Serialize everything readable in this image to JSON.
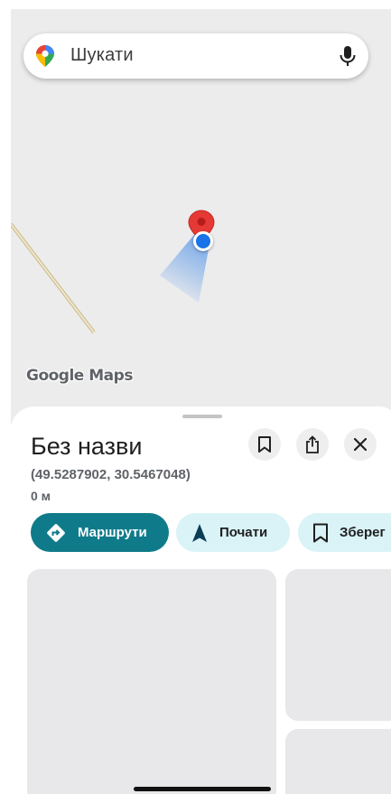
{
  "search": {
    "placeholder": "Шукати",
    "logo_icon": "google-maps-pin-icon",
    "mic_icon": "microphone-icon"
  },
  "map": {
    "watermark": "Google Maps",
    "road_color": "#d9cfae",
    "pin_color": "#e53935",
    "location_dot_color": "#1a73e8"
  },
  "place": {
    "title": "Без назви",
    "coordinates": "(49.5287902, 30.5467048)",
    "distance": "0 м",
    "actions": {
      "save_icon": "bookmark-icon",
      "share_icon": "share-icon",
      "close_icon": "close-icon"
    }
  },
  "chips": {
    "routes": "Маршрути",
    "start": "Почати",
    "save": "Зберег"
  },
  "colors": {
    "accent": "#0f7b8a",
    "chip_light": "#d9f3f7"
  }
}
